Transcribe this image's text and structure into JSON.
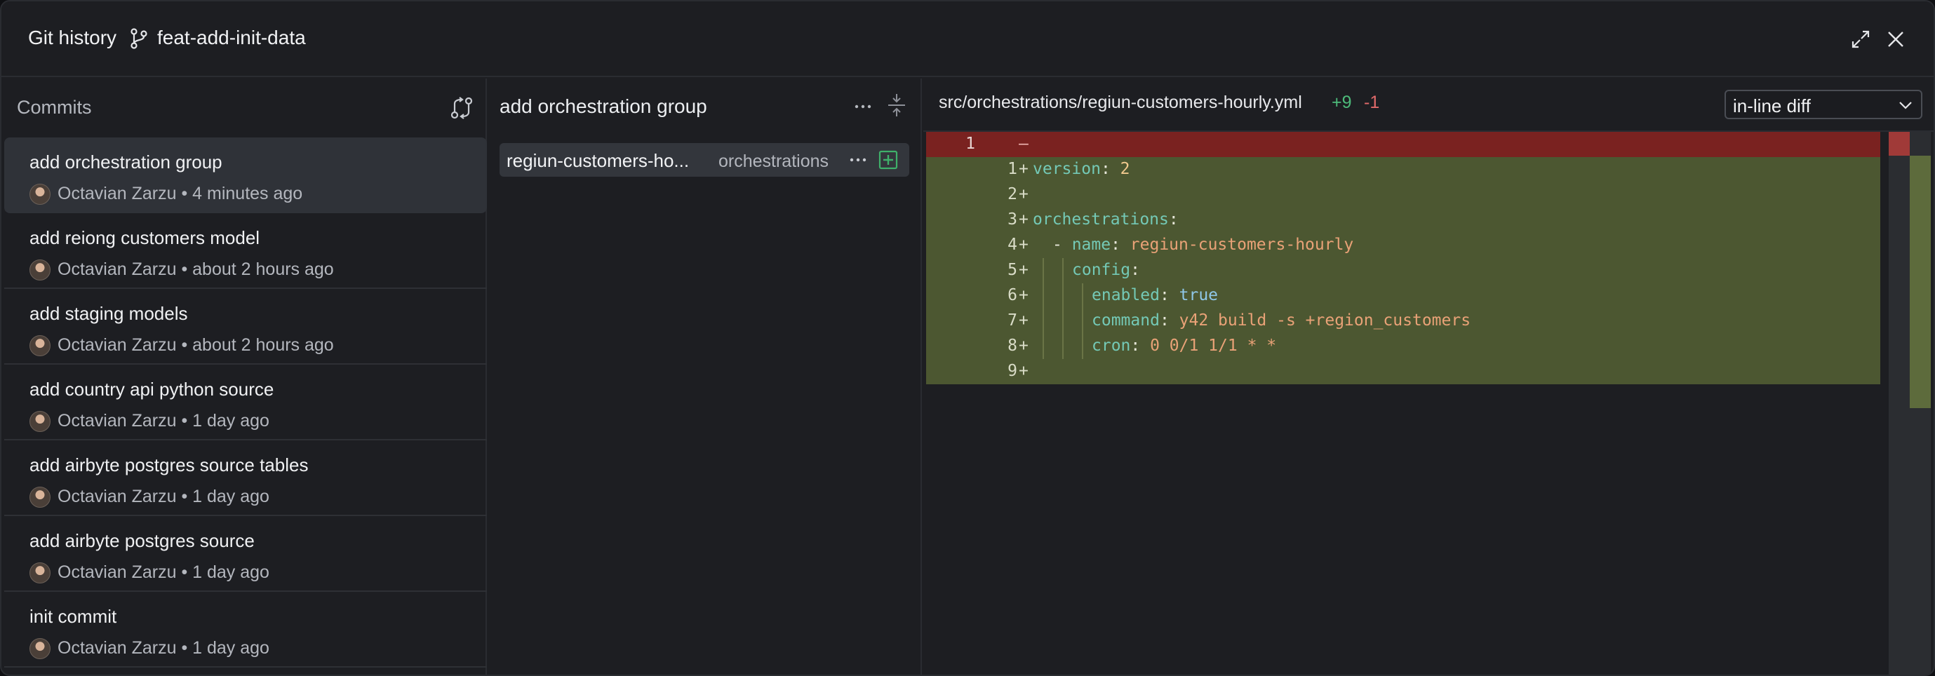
{
  "titlebar": {
    "title": "Git history",
    "branch": "feat-add-init-data"
  },
  "commits": {
    "header": "Commits",
    "items": [
      {
        "message": "add orchestration group",
        "meta": "Octavian Zarzu • 4 minutes ago",
        "selected": true
      },
      {
        "message": "add reiong customers model",
        "meta": "Octavian Zarzu • about 2 hours ago"
      },
      {
        "message": "add staging models",
        "meta": "Octavian Zarzu • about 2 hours ago"
      },
      {
        "message": "add country api python source",
        "meta": "Octavian Zarzu • 1 day ago"
      },
      {
        "message": "add airbyte postgres source tables",
        "meta": "Octavian Zarzu • 1 day ago"
      },
      {
        "message": "add airbyte postgres source",
        "meta": "Octavian Zarzu • 1 day ago"
      },
      {
        "message": "init commit",
        "meta": "Octavian Zarzu • 1 day ago"
      }
    ]
  },
  "files": {
    "header": "add orchestration group",
    "items": [
      {
        "name": "regiun-customers-ho...",
        "folder": "orchestrations",
        "more": "···"
      }
    ]
  },
  "diff": {
    "path": "src/orchestrations/regiun-customers-hourly.yml",
    "additions": "+9",
    "deletions": "-1",
    "mode": "in-line diff",
    "colors": {
      "deleted": "#7a2220",
      "added": "#4c5731",
      "key": "#74c9b6",
      "value": "#e9a277"
    },
    "deleted_line": {
      "old": "1",
      "sign": "–"
    },
    "lines": [
      {
        "n": "1",
        "indent": 0,
        "key": "version",
        "value": "2",
        "vclass": "n"
      },
      {
        "n": "2",
        "indent": 0
      },
      {
        "n": "3",
        "indent": 0,
        "key": "orchestrations",
        "value": "",
        "vclass": ""
      },
      {
        "n": "4",
        "indent": 1,
        "dash": "- ",
        "key": "name",
        "value": "regiun-customers-hourly",
        "vclass": "v"
      },
      {
        "n": "5",
        "indent": 2,
        "key": "config",
        "value": "",
        "vclass": ""
      },
      {
        "n": "6",
        "indent": 3,
        "key": "enabled",
        "value": "true",
        "vclass": "b"
      },
      {
        "n": "7",
        "indent": 3,
        "key": "command",
        "value": "y42 build -s +region_customers",
        "vclass": "v"
      },
      {
        "n": "8",
        "indent": 3,
        "key": "cron",
        "value": "0 0/1 1/1 * *",
        "vclass": "v"
      },
      {
        "n": "9",
        "indent": 0
      }
    ]
  }
}
